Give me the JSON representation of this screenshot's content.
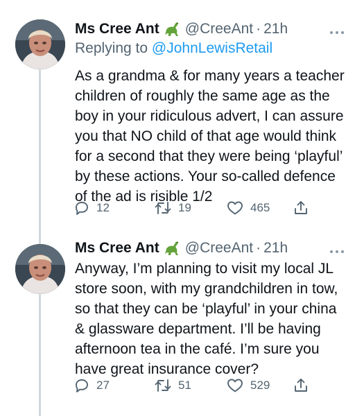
{
  "tweets": [
    {
      "name": "Ms Cree Ant",
      "emoji_icon": "sauropod-icon",
      "handle": "@CreeAnt",
      "separator": "·",
      "time": "21h",
      "replying_prefix": "Replying to",
      "replying_to": "@JohnLewisRetail",
      "text": "As a grandma & for many years a teacher children of roughly the same age as the boy in your ridiculous advert, I can assure you that NO child of that age would think for a second that they were being ‘playful’ by these actions. Your so-called defence of the ad is risible 1/2",
      "replies": "12",
      "retweets": "19",
      "likes": "465"
    },
    {
      "name": "Ms Cree Ant",
      "emoji_icon": "sauropod-icon",
      "handle": "@CreeAnt",
      "separator": "·",
      "time": "21h",
      "text": "Anyway, I’m planning to visit my local JL store soon, with my grandchildren in tow, so that they can be ‘playful’ in your china & glassware department. I’ll be having afternoon tea in the café. I’m sure you have great insurance cover?",
      "replies": "27",
      "retweets": "51",
      "likes": "529"
    }
  ],
  "colors": {
    "text": "#0f1419",
    "secondary": "#536471",
    "link": "#1d9bf0",
    "thread_line": "#cfd9de"
  }
}
